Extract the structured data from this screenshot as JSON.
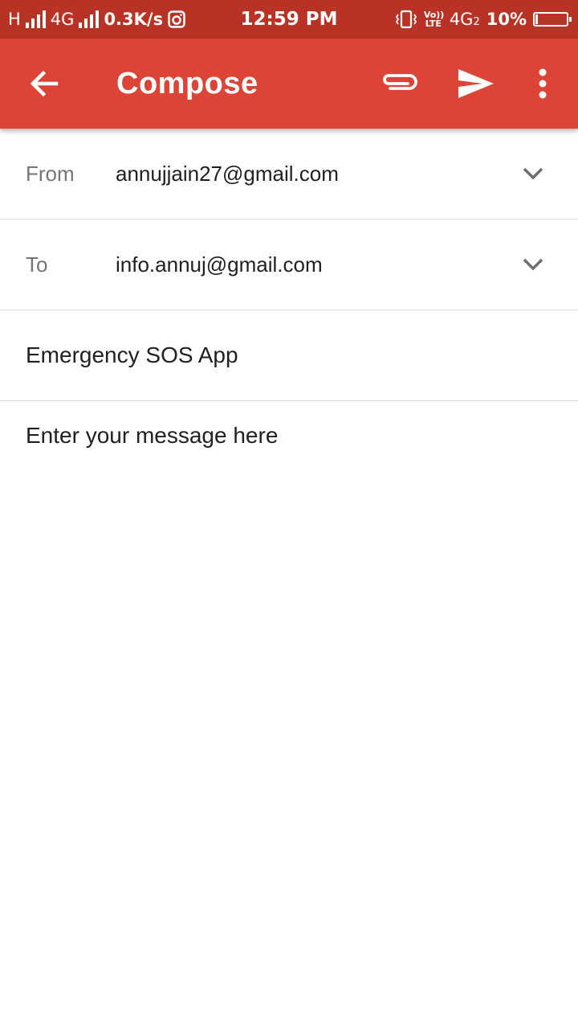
{
  "status_bar": {
    "net1": "H",
    "net2": "4G",
    "speed": "0.3K/s",
    "time": "12:59 PM",
    "volte": "Vo)) LTE",
    "net3": "4G",
    "sim2": "2",
    "battery": "10%",
    "icons": [
      "signal-icon",
      "instagram-icon",
      "vibrate-icon",
      "battery-icon"
    ]
  },
  "app_bar": {
    "title": "Compose",
    "background": "#db4437",
    "icons": [
      "back-arrow-icon",
      "attach-icon",
      "send-icon",
      "more-vert-icon"
    ]
  },
  "form": {
    "from_label": "From",
    "from_value": "annujjain27@gmail.com",
    "to_label": "To",
    "to_value": "info.annuj@gmail.com",
    "subject": "Emergency SOS App",
    "body": "Enter your message here"
  }
}
